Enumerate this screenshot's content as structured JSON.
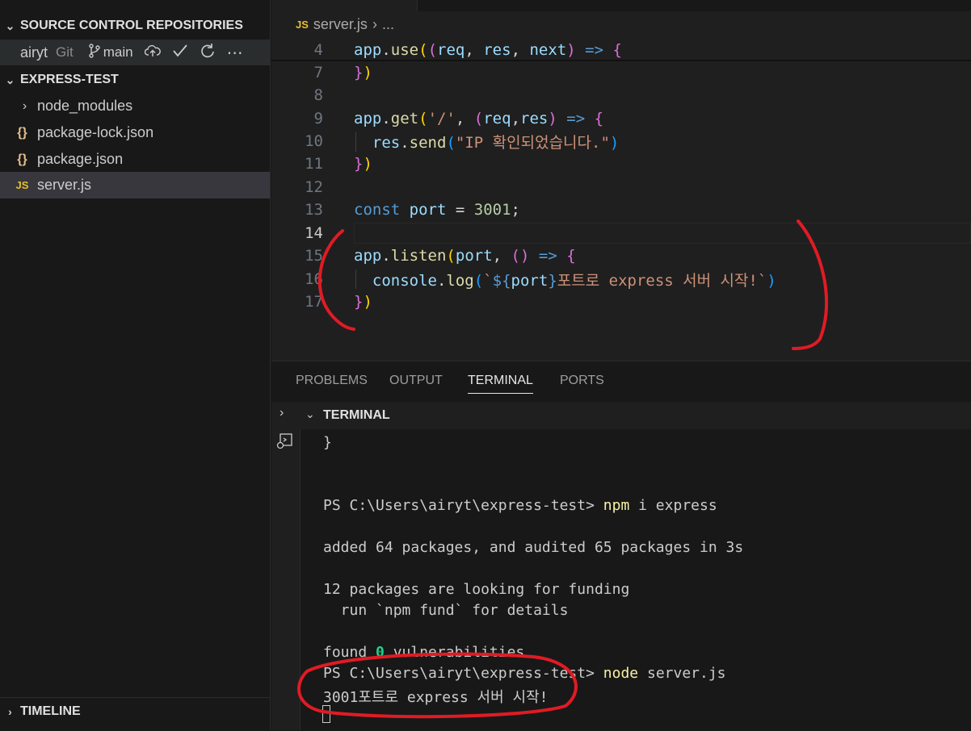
{
  "sidebar": {
    "source_control_title": "SOURCE CONTROL REPOSITORIES",
    "repo": {
      "name": "airyt",
      "type": "Git",
      "branch": "main"
    },
    "explorer_title": "EXPRESS-TEST",
    "items": [
      {
        "label": "node_modules",
        "kind": "folder"
      },
      {
        "label": "package-lock.json",
        "kind": "json"
      },
      {
        "label": "package.json",
        "kind": "json"
      },
      {
        "label": "server.js",
        "kind": "js",
        "selected": true
      }
    ],
    "json_icon": "{}",
    "js_icon": "JS",
    "timeline_title": "TIMELINE"
  },
  "editor": {
    "breadcrumb": {
      "file": "server.js",
      "rest": "..."
    },
    "line_numbers": [
      "4",
      "7",
      "8",
      "9",
      "10",
      "11",
      "12",
      "13",
      "14",
      "15",
      "16",
      "17"
    ],
    "current_line": "14"
  },
  "panel": {
    "tabs": [
      "PROBLEMS",
      "OUTPUT",
      "TERMINAL",
      "PORTS"
    ],
    "active_tab": "TERMINAL",
    "terminal_title": "TERMINAL",
    "terminal_lines": {
      "brace": "}",
      "prompt1": "PS C:\\Users\\airyt\\express-test> ",
      "cmd1": "npm",
      "cmd1_args": " i express",
      "added": "added 64 packages, and audited 65 packages in 3s",
      "funding": "12 packages are looking for funding",
      "fund_hint": "  run `npm fund` for details",
      "found": "found ",
      "found_zero": "0",
      "found_rest": " vulnerabilities",
      "prompt2": "PS C:\\Users\\airyt\\express-test> ",
      "cmd2": "node",
      "cmd2_args": " server.js",
      "output": "3001포트로 express 서버 시작!"
    }
  },
  "colors": {
    "annotation": "#e01b24",
    "accent": "#0078d4"
  }
}
